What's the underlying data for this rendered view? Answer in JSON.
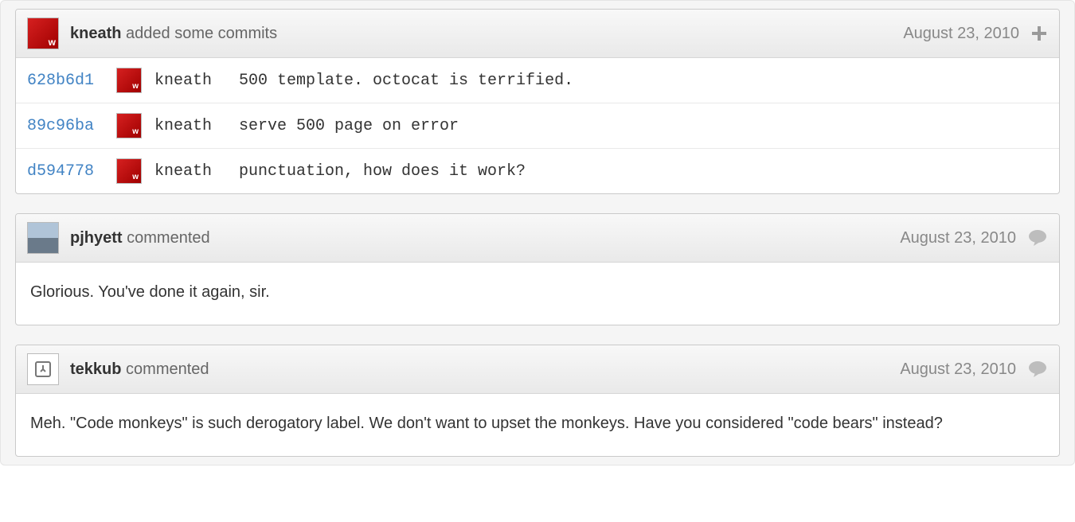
{
  "commit_block": {
    "author": "kneath",
    "action": "added some commits",
    "date": "August 23, 2010",
    "commits": [
      {
        "sha": "628b6d1",
        "author": "kneath",
        "msg": "500 template. octocat is terrified."
      },
      {
        "sha": "89c96ba",
        "author": "kneath",
        "msg": "serve 500 page on error"
      },
      {
        "sha": "d594778",
        "author": "kneath",
        "msg": "punctuation, how does it work?"
      }
    ]
  },
  "comments": [
    {
      "author": "pjhyett",
      "action": "commented",
      "date": "August 23, 2010",
      "body": "Glorious. You've done it again, sir.",
      "avatar": "photo"
    },
    {
      "author": "tekkub",
      "action": "commented",
      "date": "August 23, 2010",
      "body": "Meh. \"Code monkeys\" is such derogatory label. We don't want to upset the monkeys. Have you considered \"code bears\" instead?",
      "avatar": "icon"
    }
  ]
}
